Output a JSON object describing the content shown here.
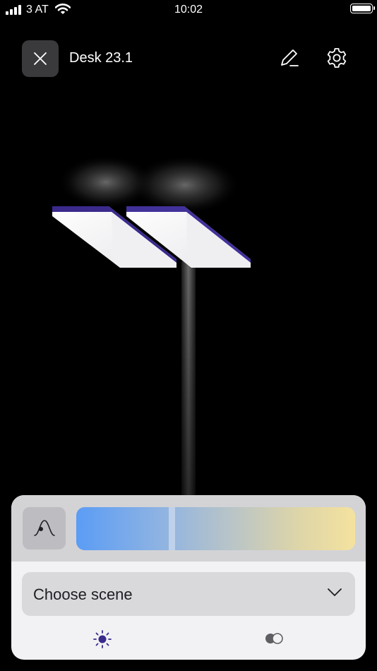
{
  "status_bar": {
    "carrier": "3 AT",
    "time": "10:02"
  },
  "header": {
    "title": "Desk 23.1",
    "close_icon": "close-icon",
    "edit_icon": "pencil-icon",
    "settings_icon": "gear-icon"
  },
  "controls": {
    "curve_icon": "bell-curve-icon",
    "color_temperature_position": 0.34,
    "scene_placeholder": "Choose scene"
  },
  "tabs": [
    {
      "icon": "sun-icon",
      "selected": true
    },
    {
      "icon": "color-mix-icon",
      "selected": false
    }
  ],
  "colors": {
    "accent": "#3b2a8c",
    "lamp_edge": "#41319a",
    "panel": "#f2f2f4"
  }
}
